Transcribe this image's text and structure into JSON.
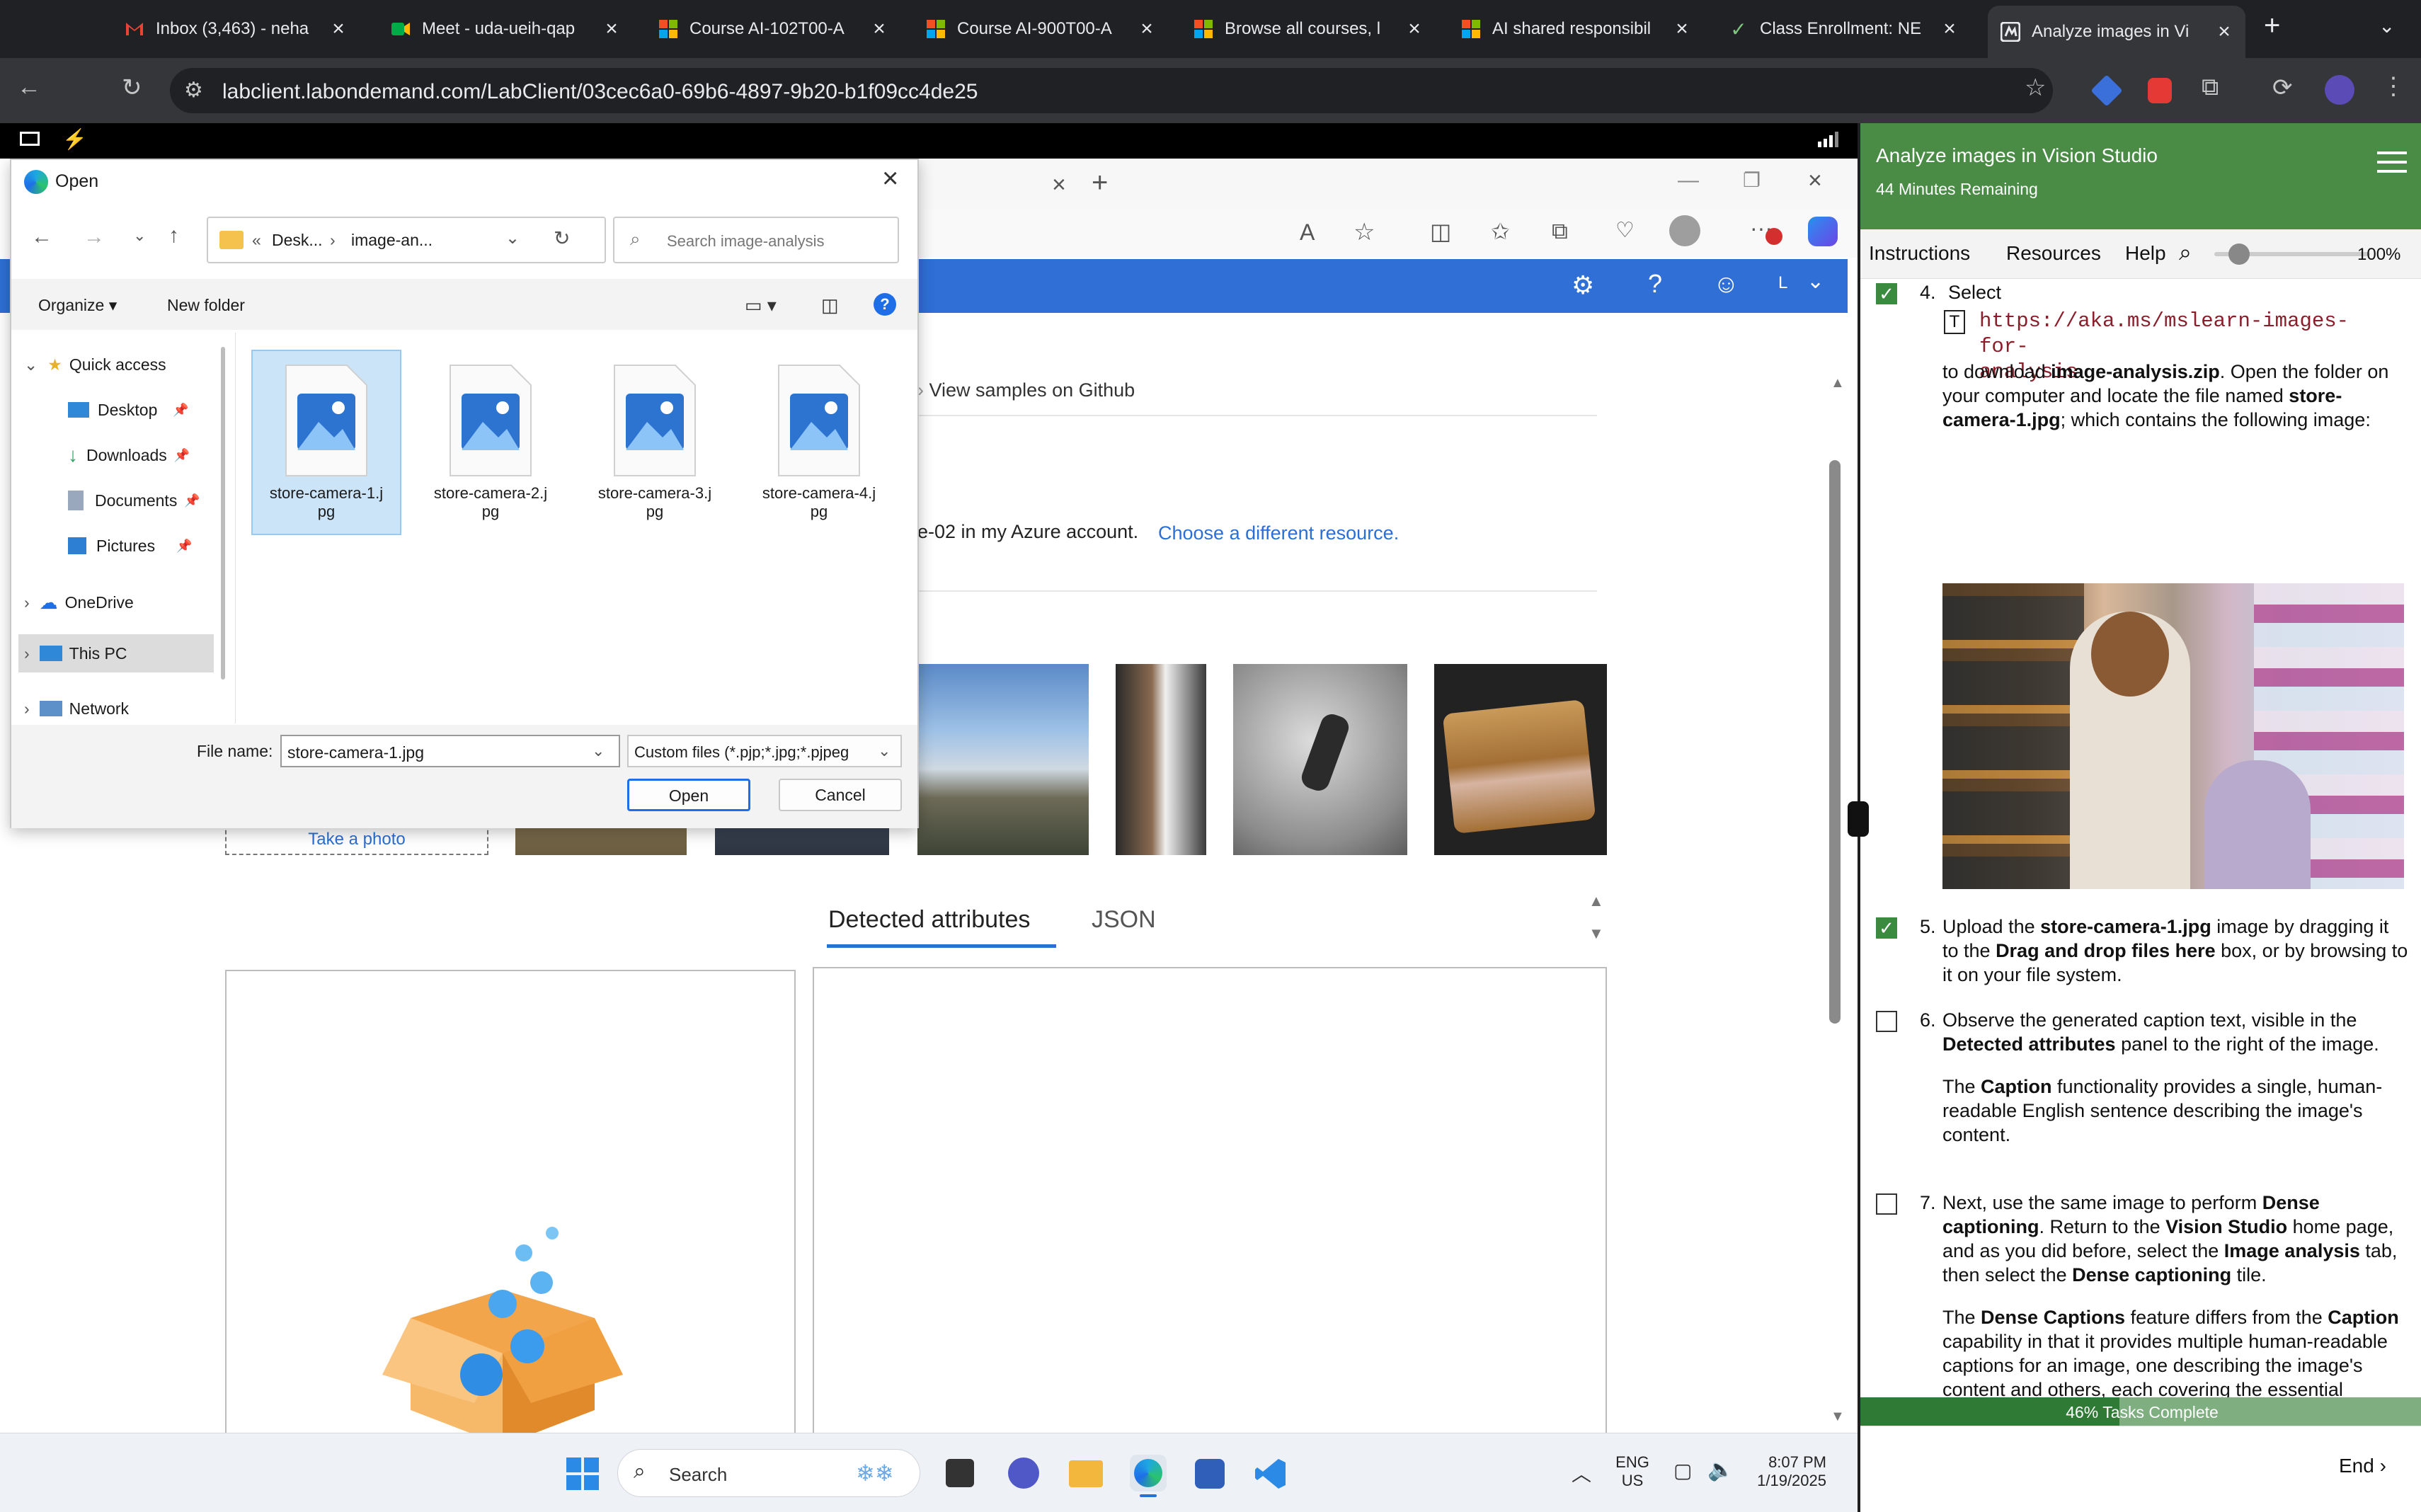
{
  "browser": {
    "tabs": [
      {
        "title": "Inbox (3,463) - neha",
        "icon": "gmail-icon"
      },
      {
        "title": "Meet - uda-ueih-qap",
        "icon": "meet-icon"
      },
      {
        "title": "Course AI-102T00-A",
        "icon": "microsoft-icon"
      },
      {
        "title": "Course AI-900T00-A",
        "icon": "microsoft-icon"
      },
      {
        "title": "Browse all courses, l",
        "icon": "microsoft-icon"
      },
      {
        "title": "AI shared responsibil",
        "icon": "microsoft-icon"
      },
      {
        "title": "Class Enrollment: NE",
        "icon": "check-icon"
      },
      {
        "title": "Analyze images in Vi",
        "icon": "lab-icon"
      }
    ],
    "url": "labclient.labondemand.com/LabClient/03cec6a0-69b6-4897-9b20-b1f09cc4de25"
  },
  "vision_page": {
    "view_samples": "View samples on Github",
    "resource_text": "e-02 in my Azure account.",
    "choose_resource": "Choose a different resource.",
    "take_photo": "Take a photo",
    "tabs": [
      "Detected attributes",
      "JSON"
    ]
  },
  "dialog": {
    "title": "Open",
    "breadcrumb": [
      "«",
      "Desk...",
      "›",
      "image-an..."
    ],
    "search_placeholder": "Search image-analysis",
    "organize": "Organize ▾",
    "new_folder": "New folder",
    "nav": [
      {
        "label": "Quick access",
        "icon": "star-icon"
      },
      {
        "label": "Desktop",
        "icon": "desktop-icon"
      },
      {
        "label": "Downloads",
        "icon": "download-icon"
      },
      {
        "label": "Documents",
        "icon": "documents-icon"
      },
      {
        "label": "Pictures",
        "icon": "pictures-icon"
      },
      {
        "label": "OneDrive",
        "icon": "cloud-icon"
      },
      {
        "label": "This PC",
        "icon": "pc-icon"
      },
      {
        "label": "Network",
        "icon": "network-icon"
      }
    ],
    "files": [
      {
        "line1": "store-camera-1.j",
        "line2": "pg"
      },
      {
        "line1": "store-camera-2.j",
        "line2": "pg"
      },
      {
        "line1": "store-camera-3.j",
        "line2": "pg"
      },
      {
        "line1": "store-camera-4.j",
        "line2": "pg"
      }
    ],
    "file_name_label": "File name:",
    "file_name_value": "store-camera-1.jpg",
    "file_type": "Custom files (*.pjp;*.jpg;*.pjpeg",
    "open_button": "Open",
    "cancel_button": "Cancel"
  },
  "taskbar": {
    "search": "Search",
    "lang1": "ENG",
    "lang2": "US",
    "time": "8:07 PM",
    "date": "1/19/2025"
  },
  "lab_panel": {
    "title": "Analyze images in Vision Studio",
    "time_remaining": "44 Minutes Remaining",
    "tabs": [
      "Instructions",
      "Resources",
      "Help"
    ],
    "zoom": "100%",
    "step4": {
      "num": "4.",
      "lead": "Select",
      "link1": "https://aka.ms/mslearn-images-for-",
      "link2": "analysis",
      "t1": "to download ",
      "b1": "image-analysis.zip",
      "t2": ". Open the folder on your computer and locate the file named ",
      "b2": "store-camera-1.jpg",
      "t3": "; which contains the following image:"
    },
    "step5": {
      "num": "5.",
      "t1": "Upload the ",
      "b1": "store-camera-1.jpg",
      "t2": " image by dragging it to the ",
      "b2": "Drag and drop files here",
      "t3": " box, or by browsing to it on your file system."
    },
    "step6": {
      "num": "6.",
      "t1": "Observe the generated caption text, visible in the ",
      "b1": "Detected attributes",
      "t2": " panel to the right of the image.",
      "p_b": "The ",
      "p_b1": "Caption",
      "p_t": " functionality provides a single, human-readable English sentence describing the image's content."
    },
    "step7": {
      "num": "7.",
      "t1": "Next, use the same image to perform ",
      "b1": "Dense captioning",
      "t2": ". Return to the ",
      "b2": "Vision Studio",
      "t3": " home page, and as you did before, select the ",
      "b3": "Image analysis",
      "t4": " tab, then select the ",
      "b4": "Dense captioning",
      "t5": " tile.",
      "p1": "The ",
      "pb1": "Dense Captions",
      "p2": " feature differs from the ",
      "pb2": "Caption",
      "p3": " capability in that it provides multiple human-readable captions for an image, one describing the image's content and others, each covering the essential objects detected in the picture. Each detected object includes a bounding box, which defines the pixel coordinates within the image associated with the object."
    },
    "progress_text": "46% Tasks Complete",
    "progress": 0.46,
    "end_button": "End"
  },
  "colors": {
    "panel_green": "#4a8c46",
    "progress_green": "#2f7a34",
    "edge_blue": "#2f6fd6"
  }
}
